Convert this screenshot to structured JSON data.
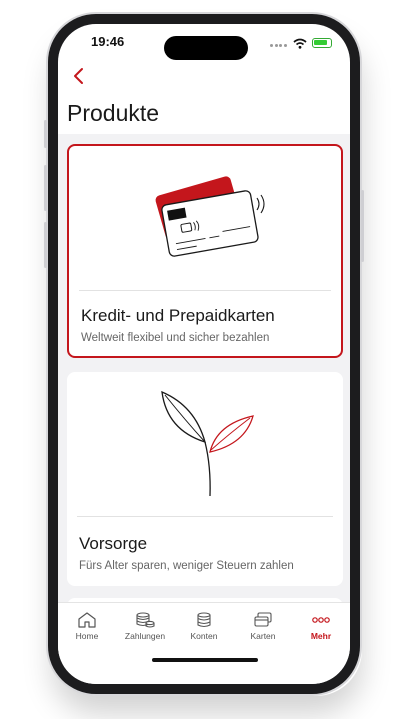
{
  "status": {
    "time": "19:46"
  },
  "header": {
    "title": "Produkte"
  },
  "cards": [
    {
      "title": "Kredit- und Prepaidkarten",
      "subtitle": "Weltweit flexibel und sicher bezahlen"
    },
    {
      "title": "Vorsorge",
      "subtitle": "Fürs Alter sparen, weniger Steuern zahlen"
    }
  ],
  "tabs": [
    {
      "label": "Home",
      "icon": "home-icon"
    },
    {
      "label": "Zahlungen",
      "icon": "coins-icon"
    },
    {
      "label": "Konten",
      "icon": "coin-stack-icon"
    },
    {
      "label": "Karten",
      "icon": "cards-icon"
    },
    {
      "label": "Mehr",
      "icon": "more-icon",
      "active": true
    }
  ],
  "colors": {
    "accent": "#c4161c",
    "background": "#f2f2f4"
  }
}
